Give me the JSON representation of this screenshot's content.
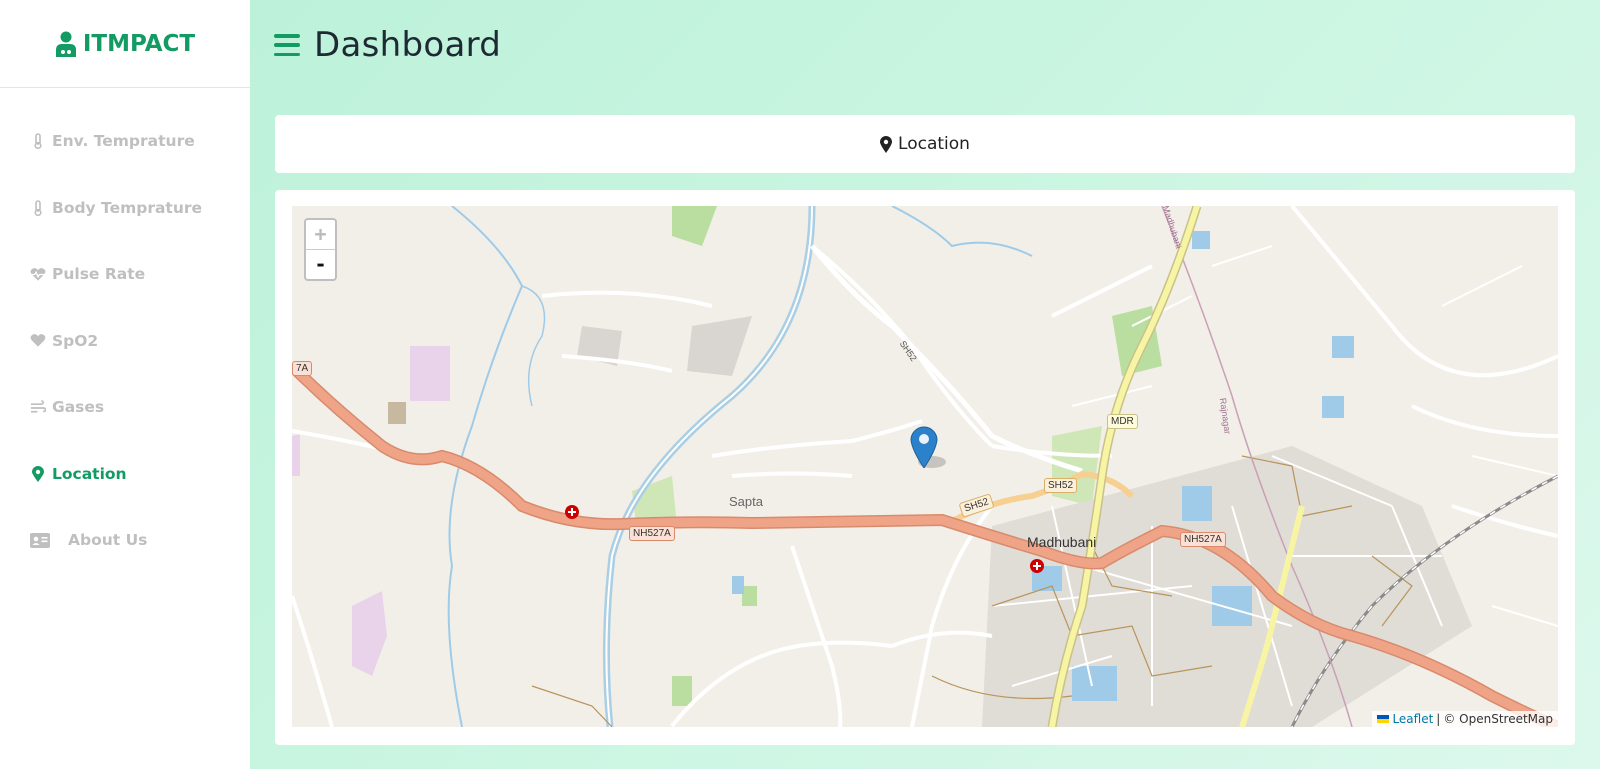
{
  "brand": {
    "name": "ITMPACT",
    "icon": "doctor-icon",
    "color": "#139b63"
  },
  "sidebar": {
    "items": [
      {
        "label": "Env. Temprature",
        "icon": "thermometer-icon",
        "active": false
      },
      {
        "label": "Body Temprature",
        "icon": "thermometer-icon",
        "active": false
      },
      {
        "label": "Pulse Rate",
        "icon": "heart-pulse-icon",
        "active": false
      },
      {
        "label": "SpO2",
        "icon": "heart-icon",
        "active": false
      },
      {
        "label": "Gases",
        "icon": "wind-icon",
        "active": false
      },
      {
        "label": "Location",
        "icon": "map-pin-icon",
        "active": true
      },
      {
        "label": "About Us",
        "icon": "id-card-icon",
        "active": false
      }
    ]
  },
  "header": {
    "title": "Dashboard"
  },
  "location_card": {
    "label": "Location"
  },
  "map": {
    "zoom_in": "+",
    "zoom_out": "-",
    "attribution": {
      "link": "Leaflet",
      "separator": "|",
      "credit": "© OpenStreetMap"
    },
    "place_labels": {
      "town": "Madhubani",
      "village": "Sapta"
    },
    "road_labels": {
      "nh_left": "NH527A",
      "nh_right": "NH527A",
      "nh_edge": "7A",
      "sh_top": "SH52",
      "sh_mid": "SH52",
      "sh_lower": "SH52",
      "mdr": "MDR",
      "rail1": "Madhubani",
      "rail2": "Rajnagar"
    },
    "colors": {
      "highway": "#f0a487",
      "secondary": "#f6cf91",
      "primary": "#f7f4a3",
      "water": "#9fcbe8",
      "green": "#b9dea0"
    }
  }
}
